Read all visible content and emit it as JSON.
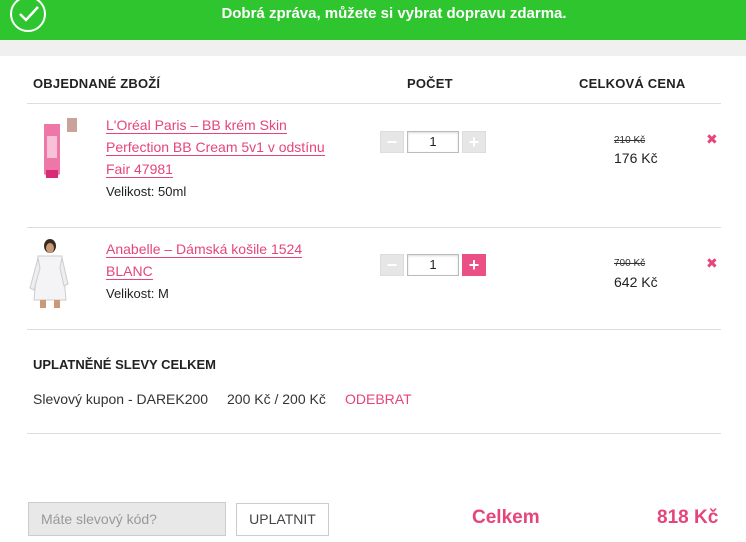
{
  "banner": {
    "message": "Dobrá zpráva, můžete si vybrat dopravu zdarma."
  },
  "colors": {
    "accent": "#e5457a",
    "banner": "#2fc52f"
  },
  "table": {
    "headers": {
      "product": "OBJEDNANÉ ZBOŽÍ",
      "qty": "POČET",
      "total": "CELKOVÁ CENA"
    },
    "items": [
      {
        "name": "L'Oréal Paris – BB krém Skin Perfection BB Cream 5v1 v odstínu Fair 47981",
        "size": "Velikost: 50ml",
        "qty": "1",
        "old_price": "210 Kč",
        "price": "176 Kč",
        "minus": "−",
        "plus": "+",
        "remove": "✖"
      },
      {
        "name": "Anabelle – Dámská košile 1524 BLANC",
        "size": "Velikost: M",
        "qty": "1",
        "old_price": "700 Kč",
        "price": "642 Kč",
        "minus": "−",
        "plus": "+",
        "remove": "✖"
      }
    ]
  },
  "discounts": {
    "title": "UPLATNĚNÉ SLEVY CELKEM",
    "coupon_label": "Slevový kupon - DAREK200",
    "amount": "200 Kč / 200 Kč",
    "remove": "ODEBRAT"
  },
  "footer": {
    "coupon_placeholder": "Máte slevový kód?",
    "apply": "UPLATNIT",
    "total_label": "Celkem",
    "total_value": "818 Kč"
  }
}
